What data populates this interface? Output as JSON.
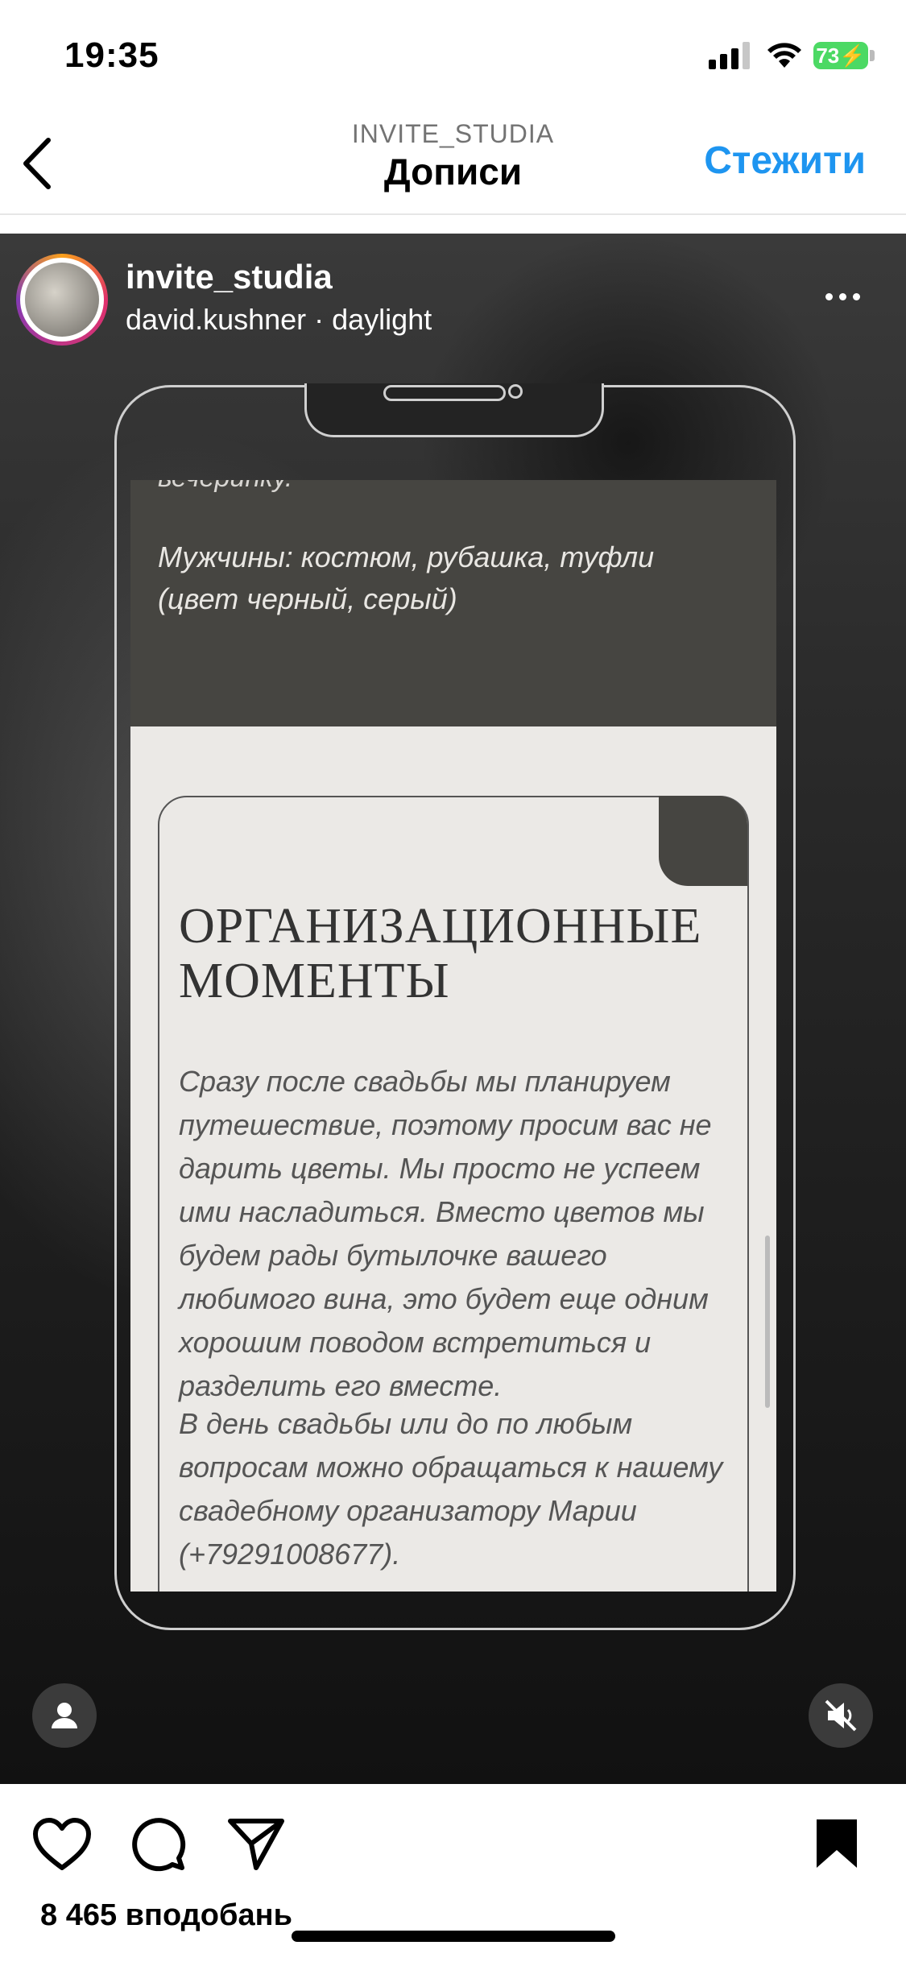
{
  "status": {
    "time": "19:35",
    "battery": "73"
  },
  "nav": {
    "subtitle": "INVITE_STUDIA",
    "title": "Дописи",
    "follow": "Стежити"
  },
  "post": {
    "username": "invite_studia",
    "music": "david.kushner · daylight",
    "content": {
      "cut_text": "вечеринку.",
      "dress_code": "Мужчины: костюм, рубашка, туфли (цвет черный, серый)",
      "card_title": "ОРГАНИЗАЦИОННЫЕ МОМЕНТЫ",
      "paragraph1": "Сразу после свадьбы мы планируем путешествие, поэтому просим вас не дарить цветы. Мы просто не успеем ими насладиться. Вместо цветов мы будем рады бутылочке вашего любимого вина, это будет еще одним хорошим поводом встретиться и разделить его вместе.",
      "paragraph2": "В день свадьбы или до по любым вопросам можно обращаться к нашему свадебному организатору Марии (+79291008677)."
    }
  },
  "actions": {
    "likes": "8 465 вподобань"
  },
  "colors": {
    "accent": "#1e95f0",
    "battery": "#4cd964",
    "dark_band": "#464541"
  }
}
